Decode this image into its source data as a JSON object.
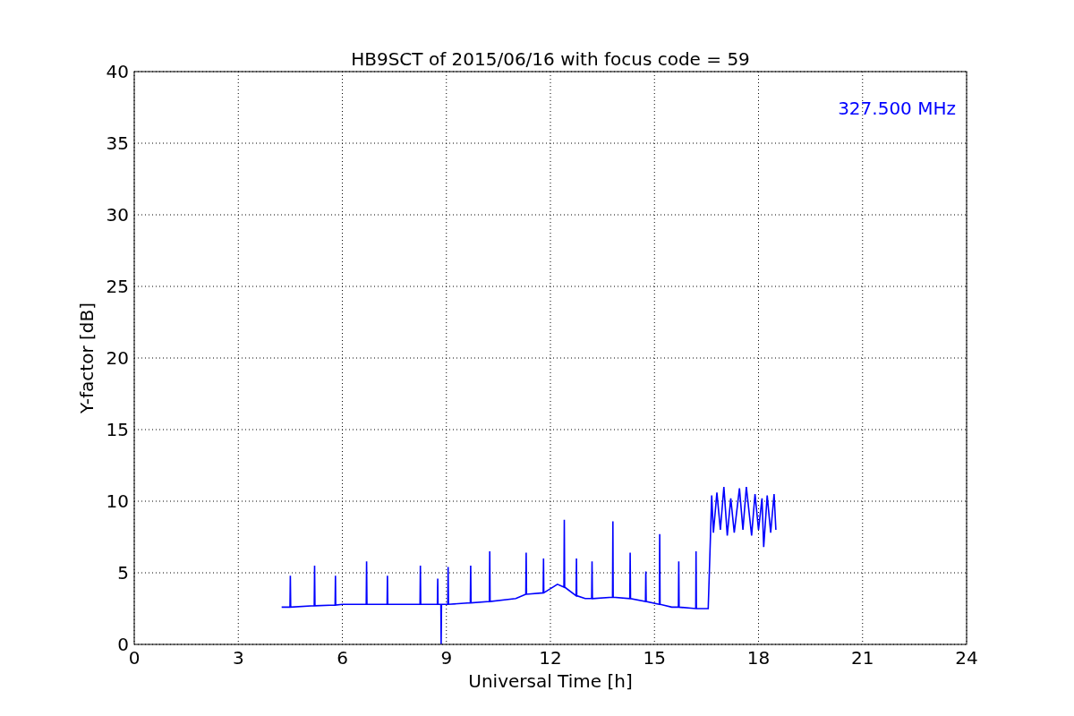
{
  "chart_data": {
    "type": "line",
    "title": "HB9SCT of 2015/06/16 with focus code = 59",
    "xlabel": "Universal Time [h]",
    "ylabel": "Y-factor [dB]",
    "xlim": [
      0,
      24
    ],
    "ylim": [
      0,
      40
    ],
    "xticks": [
      0,
      3,
      6,
      9,
      12,
      15,
      18,
      21,
      24
    ],
    "yticks": [
      0,
      5,
      10,
      15,
      20,
      25,
      30,
      35,
      40
    ],
    "x": [
      4.25,
      4.49,
      4.5,
      4.51,
      5.19,
      5.2,
      5.21,
      5.79,
      5.8,
      5.81,
      6.0,
      6.69,
      6.7,
      6.71,
      7.29,
      7.3,
      7.31,
      8.24,
      8.25,
      8.26,
      8.74,
      8.75,
      8.76,
      8.84,
      8.85,
      8.86,
      9.04,
      9.05,
      9.06,
      9.69,
      9.7,
      9.71,
      10.24,
      10.25,
      10.26,
      11.0,
      11.29,
      11.3,
      11.31,
      11.79,
      11.8,
      11.81,
      12.2,
      12.39,
      12.4,
      12.41,
      12.74,
      12.75,
      12.76,
      13.0,
      13.19,
      13.2,
      13.21,
      13.79,
      13.8,
      13.81,
      14.29,
      14.3,
      14.31,
      14.74,
      14.75,
      14.76,
      15.14,
      15.15,
      15.16,
      15.5,
      15.69,
      15.7,
      15.71,
      16.19,
      16.2,
      16.21,
      16.55,
      16.6,
      16.65,
      16.7,
      16.8,
      16.9,
      17.0,
      17.1,
      17.2,
      17.3,
      17.45,
      17.55,
      17.65,
      17.8,
      17.9,
      18.0,
      18.1,
      18.15,
      18.25,
      18.35,
      18.45,
      18.5
    ],
    "series": [
      {
        "color": "#0000ff",
        "values": [
          2.6,
          2.6,
          4.8,
          2.6,
          2.7,
          5.5,
          2.7,
          2.75,
          4.8,
          2.75,
          2.8,
          2.8,
          5.8,
          2.8,
          2.8,
          4.8,
          2.8,
          2.8,
          5.5,
          2.8,
          2.8,
          4.6,
          2.8,
          2.8,
          0,
          2.8,
          2.8,
          5.4,
          2.8,
          2.9,
          5.5,
          2.9,
          3.0,
          6.5,
          3.0,
          3.2,
          3.5,
          6.4,
          3.5,
          3.6,
          6.0,
          3.6,
          4.2,
          4.0,
          8.7,
          4.0,
          3.4,
          6.0,
          3.4,
          3.2,
          3.2,
          5.8,
          3.2,
          3.3,
          8.6,
          3.3,
          3.2,
          6.4,
          3.2,
          3.0,
          5.1,
          3.0,
          2.8,
          7.7,
          2.8,
          2.6,
          2.6,
          5.8,
          2.6,
          2.5,
          6.5,
          2.5,
          2.5,
          6.5,
          10.4,
          7.8,
          10.6,
          8.0,
          11.0,
          7.6,
          10.2,
          7.8,
          10.9,
          8.0,
          11.0,
          7.6,
          10.5,
          8.0,
          10.2,
          6.8,
          10.4,
          7.8,
          10.5,
          8.0
        ]
      }
    ],
    "grid": true,
    "annotations": [
      "327.500 MHz"
    ]
  }
}
